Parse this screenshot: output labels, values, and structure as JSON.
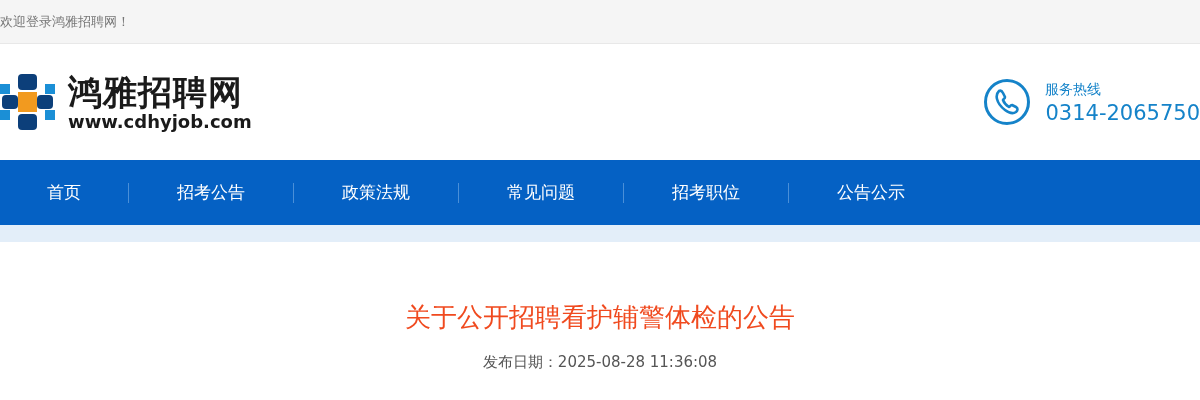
{
  "top_bar": {
    "welcome": "欢迎登录鸿雅招聘网！"
  },
  "header": {
    "logo_name": "鸿雅招聘网",
    "logo_url": "www.cdhyjob.com",
    "hotline_label": "服务热线",
    "hotline_number": "0314-2065750"
  },
  "nav": [
    {
      "label": "首页"
    },
    {
      "label": "招考公告"
    },
    {
      "label": "政策法规"
    },
    {
      "label": "常见问题"
    },
    {
      "label": "招考职位"
    },
    {
      "label": "公告公示"
    }
  ],
  "article": {
    "title": "关于公开招聘看护辅警体检的公告",
    "date": "发布日期：2025-08-28 11:36:08"
  }
}
